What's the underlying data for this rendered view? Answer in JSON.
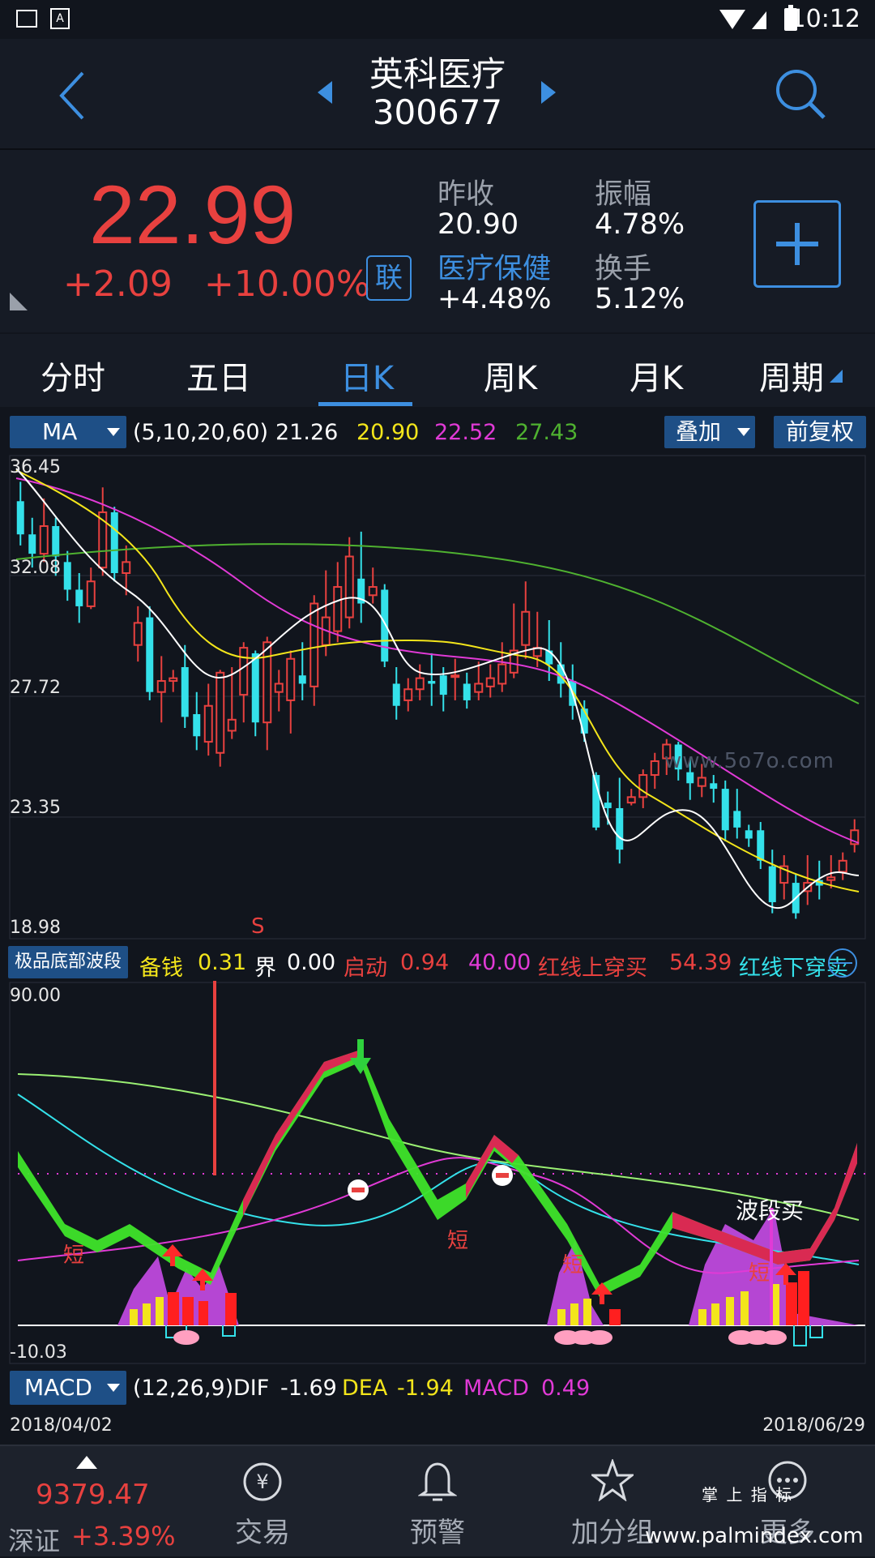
{
  "status": {
    "time": "10:12"
  },
  "header": {
    "stock_name": "英科医疗",
    "stock_code": "300677"
  },
  "quote": {
    "price": "22.99",
    "change": "+2.09",
    "change_pct": "+10.00%",
    "link_badge": "联",
    "prev_close_label": "昨收",
    "prev_close": "20.90",
    "amplitude_label": "振幅",
    "amplitude": "4.78%",
    "sector_label": "医疗保健",
    "sector_change": "+4.48%",
    "turnover_label": "换手",
    "turnover": "5.12%"
  },
  "tabs": [
    "分时",
    "五日",
    "日K",
    "周K",
    "月K",
    "周期"
  ],
  "ma_bar": {
    "selector": "MA",
    "params": "(5,10,20,60)",
    "ma5": "21.26",
    "ma10": "20.90",
    "ma20": "22.52",
    "ma60": "27.43",
    "overlay_button": "叠加",
    "adjust_button": "前复权"
  },
  "kchart": {
    "y_labels": [
      "36.45",
      "32.08",
      "27.72",
      "23.35",
      "18.98"
    ],
    "s_marker": "S",
    "watermark": "www.5o7o.com"
  },
  "indicator": {
    "name": "极品底部波段",
    "b1_label": "备钱",
    "b1_value": "0.31",
    "b2_label": "界",
    "b2_value": "0.00",
    "b3_label": "启动",
    "b3_value": "0.94",
    "b4_value": "40.00",
    "b5_label": "红线上穿买",
    "b5_value": "54.39",
    "b6_label": "红线下穿卖",
    "y_top": "90.00",
    "y_bottom": "-10.03",
    "short_mark": "短",
    "wave_buy": "波段买"
  },
  "macd_bar": {
    "selector": "MACD",
    "params": "(12,26,9)",
    "dif_label": "DIF",
    "dif": "-1.69",
    "dea_label": "DEA",
    "dea": "-1.94",
    "macd_label": "MACD",
    "macd": "0.49"
  },
  "dates": {
    "start": "2018/04/02",
    "end": "2018/06/29"
  },
  "bottom_nav": {
    "index_value": "9379.47",
    "index_name": "深证",
    "index_change": "+3.39%",
    "items": [
      "交易",
      "预警",
      "加分组",
      "更多"
    ],
    "watermark_top": "掌 上 指 标",
    "watermark_url": "www.palmindex.com"
  },
  "colors": {
    "up": "#e8413f",
    "down": "#34e1ea",
    "ma5": "#ffffff",
    "ma10": "#f3e51b",
    "ma20": "#e13ad6",
    "ma60": "#4fb230",
    "accent": "#3d8fe0"
  },
  "chart_data": {
    "type": "candlestick",
    "ylim": [
      18.98,
      36.45
    ],
    "candles": [
      [
        34.8,
        33.6,
        35.5,
        33.2
      ],
      [
        33.6,
        32.9,
        34.2,
        32.4
      ],
      [
        32.9,
        33.9,
        34.9,
        32.6
      ],
      [
        33.9,
        32.8,
        34.2,
        32.1
      ],
      [
        32.6,
        31.6,
        33.0,
        31.2
      ],
      [
        31.6,
        31.0,
        32.2,
        30.4
      ],
      [
        31.0,
        31.9,
        32.4,
        30.9
      ],
      [
        32.4,
        34.4,
        35.3,
        32.1
      ],
      [
        34.4,
        32.2,
        34.6,
        31.9
      ],
      [
        32.2,
        32.6,
        33.2,
        31.4
      ],
      [
        29.6,
        30.4,
        31.0,
        29.0
      ],
      [
        30.6,
        27.9,
        31.0,
        27.6
      ],
      [
        27.9,
        28.3,
        29.2,
        26.8
      ],
      [
        28.3,
        28.4,
        28.7,
        27.9
      ],
      [
        28.8,
        27.0,
        29.6,
        26.6
      ],
      [
        27.1,
        26.3,
        27.9,
        25.8
      ],
      [
        26.1,
        27.4,
        28.2,
        25.6
      ],
      [
        25.7,
        28.6,
        28.7,
        25.2
      ],
      [
        26.5,
        26.9,
        28.8,
        26.2
      ],
      [
        27.8,
        29.5,
        29.7,
        26.8
      ],
      [
        29.3,
        26.8,
        29.4,
        26.3
      ],
      [
        26.8,
        29.7,
        29.9,
        25.8
      ],
      [
        27.9,
        28.2,
        28.7,
        27.2
      ],
      [
        27.6,
        29.1,
        29.4,
        26.4
      ],
      [
        28.5,
        28.2,
        29.7,
        27.6
      ],
      [
        28.1,
        31.1,
        31.4,
        27.4
      ],
      [
        29.6,
        30.6,
        32.3,
        29.2
      ],
      [
        30.1,
        31.7,
        32.6,
        29.7
      ],
      [
        30.6,
        32.8,
        33.5,
        30.2
      ],
      [
        32.0,
        31.1,
        33.7,
        30.4
      ],
      [
        31.4,
        31.7,
        32.4,
        31.1
      ],
      [
        31.6,
        29.0,
        31.8,
        28.8
      ],
      [
        28.2,
        27.4,
        28.8,
        26.9
      ],
      [
        27.6,
        28.0,
        28.4,
        27.2
      ],
      [
        28.0,
        28.4,
        28.9,
        27.6
      ],
      [
        28.3,
        28.2,
        29.3,
        27.4
      ],
      [
        28.5,
        27.8,
        28.8,
        27.2
      ],
      [
        28.5,
        28.5,
        29.1,
        27.6
      ],
      [
        28.2,
        27.6,
        28.6,
        27.3
      ],
      [
        27.9,
        28.2,
        29.0,
        27.6
      ],
      [
        28.1,
        28.4,
        28.9,
        27.7
      ],
      [
        28.2,
        28.9,
        29.7,
        27.9
      ],
      [
        28.6,
        29.4,
        31.1,
        28.4
      ],
      [
        29.6,
        30.8,
        31.9,
        29.1
      ],
      [
        29.2,
        29.5,
        30.8,
        28.8
      ],
      [
        29.4,
        28.9,
        30.5,
        28.3
      ],
      [
        28.9,
        28.2,
        29.7,
        27.7
      ],
      [
        28.3,
        27.4,
        28.9,
        26.9
      ],
      [
        27.3,
        26.4,
        27.6,
        26.1
      ],
      [
        24.9,
        23.0,
        25.0,
        22.9
      ],
      [
        23.9,
        23.7,
        24.3,
        23.1
      ],
      [
        23.7,
        22.2,
        24.8,
        21.7
      ],
      [
        23.9,
        24.1,
        24.4,
        23.8
      ],
      [
        24.1,
        24.9,
        25.1,
        23.7
      ],
      [
        24.9,
        25.4,
        25.7,
        24.4
      ],
      [
        25.5,
        26.0,
        26.2,
        24.9
      ],
      [
        26.0,
        25.1,
        26.1,
        24.7
      ],
      [
        25.0,
        24.6,
        25.5,
        24.0
      ],
      [
        24.5,
        24.8,
        25.3,
        24.1
      ],
      [
        24.6,
        24.4,
        24.9,
        23.9
      ],
      [
        24.4,
        22.9,
        24.7,
        22.5
      ],
      [
        23.6,
        23.0,
        24.4,
        22.6
      ],
      [
        22.9,
        22.6,
        23.1,
        22.3
      ],
      [
        22.9,
        21.8,
        23.2,
        21.5
      ],
      [
        21.6,
        20.3,
        22.2,
        19.9
      ],
      [
        21.0,
        21.6,
        22.0,
        20.4
      ],
      [
        21.0,
        19.9,
        21.3,
        19.7
      ],
      [
        20.7,
        21.0,
        22.0,
        20.2
      ],
      [
        21.1,
        20.9,
        21.8,
        20.4
      ],
      [
        21.1,
        21.2,
        22.0,
        20.8
      ],
      [
        21.4,
        21.8,
        22.1,
        21.1
      ],
      [
        22.4,
        22.9,
        23.3,
        22.1
      ]
    ]
  }
}
